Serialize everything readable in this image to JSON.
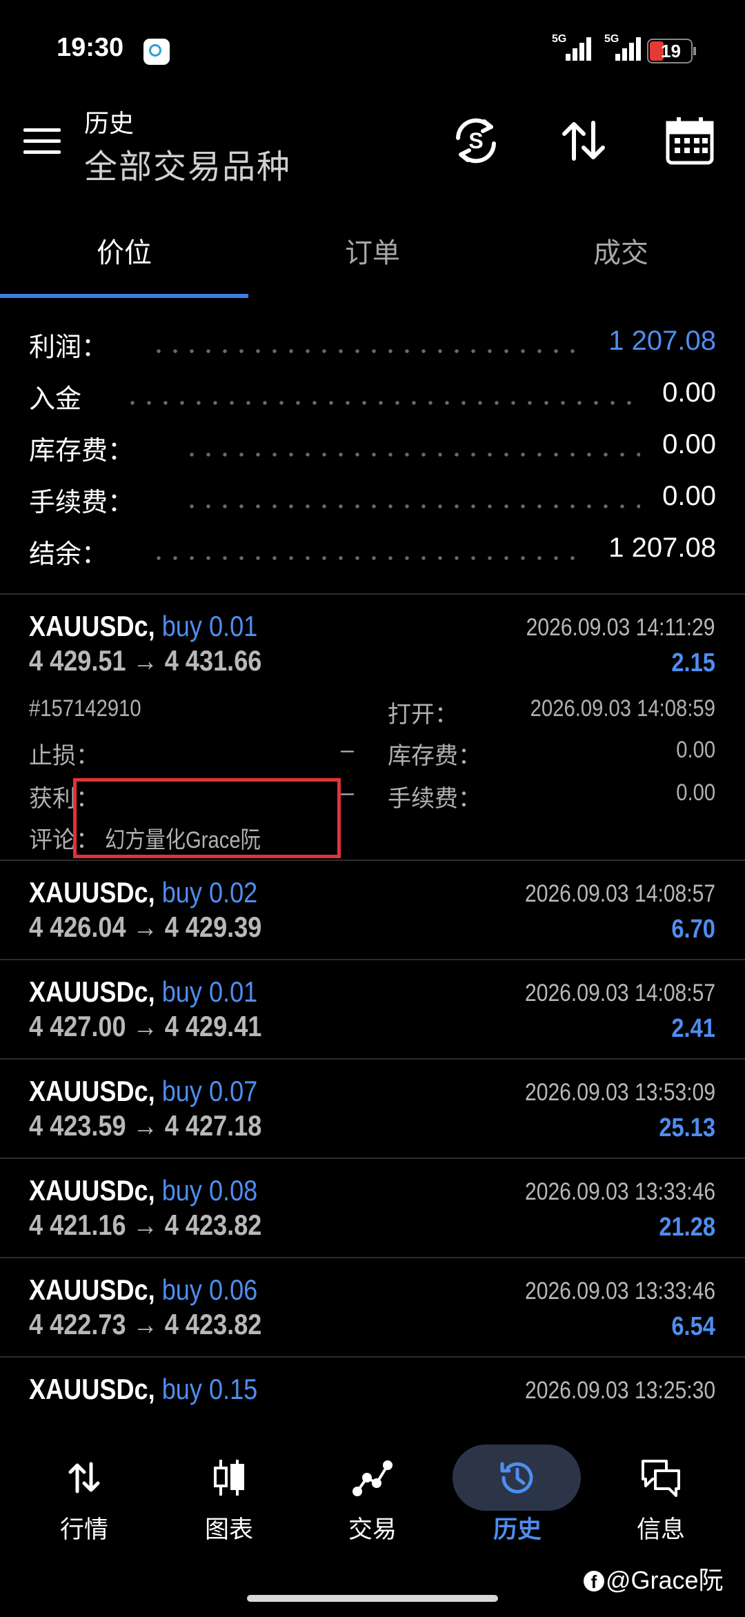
{
  "status_bar": {
    "time": "19:30",
    "signal1_label": "5G",
    "signal2_label": "5G",
    "battery": "19"
  },
  "header": {
    "subtitle": "历史",
    "title": "全部交易品种"
  },
  "tabs": [
    {
      "label": "价位",
      "active": true
    },
    {
      "label": "订单",
      "active": false
    },
    {
      "label": "成交",
      "active": false
    }
  ],
  "summary": [
    {
      "label": "利润：",
      "value": "1 207.08",
      "accent": true
    },
    {
      "label": "入金",
      "value": "0.00",
      "accent": false
    },
    {
      "label": "库存费：",
      "value": "0.00",
      "accent": false
    },
    {
      "label": "手续费：",
      "value": "0.00",
      "accent": false
    },
    {
      "label": "结余：",
      "value": "1 207.08",
      "accent": false
    }
  ],
  "trades": [
    {
      "symbol": "XAUUSDc,",
      "side_volume": "buy 0.01",
      "prices": "4 429.51 → 4 431.66",
      "time": "2026.09.03 14:11:29",
      "profit": "2.15"
    },
    {
      "symbol": "XAUUSDc,",
      "side_volume": "buy 0.02",
      "prices": "4 426.04 → 4 429.39",
      "time": "2026.09.03 14:08:57",
      "profit": "6.70"
    },
    {
      "symbol": "XAUUSDc,",
      "side_volume": "buy 0.01",
      "prices": "4 427.00 → 4 429.41",
      "time": "2026.09.03 14:08:57",
      "profit": "2.41"
    },
    {
      "symbol": "XAUUSDc,",
      "side_volume": "buy 0.07",
      "prices": "4 423.59 → 4 427.18",
      "time": "2026.09.03 13:53:09",
      "profit": "25.13"
    },
    {
      "symbol": "XAUUSDc,",
      "side_volume": "buy 0.08",
      "prices": "4 421.16 → 4 423.82",
      "time": "2026.09.03 13:33:46",
      "profit": "21.28"
    },
    {
      "symbol": "XAUUSDc,",
      "side_volume": "buy 0.06",
      "prices": "4 422.73 → 4 423.82",
      "time": "2026.09.03 13:33:46",
      "profit": "6.54"
    },
    {
      "symbol": "XAUUSDc,",
      "side_volume": "buy 0.15",
      "prices": "",
      "time": "2026.09.03 13:25:30",
      "profit": ""
    }
  ],
  "trade_details": {
    "ticket": "#157142910",
    "open_label": "打开：",
    "open_time": "2026.09.03 14:08:59",
    "sl_label": "止损：",
    "sl_value": "–",
    "swap_label": "库存费：",
    "swap_value": "0.00",
    "tp_label": "获利：",
    "tp_value": "–",
    "commission_label": "手续费：",
    "commission_value": "0.00",
    "comment_label": "评论：",
    "comment_value": "幻方量化Grace阮"
  },
  "bottom_nav": [
    {
      "label": "行情",
      "icon": "quotes-arrows-icon",
      "active": false
    },
    {
      "label": "图表",
      "icon": "candlestick-chart-icon",
      "active": false
    },
    {
      "label": "交易",
      "icon": "trade-line-icon",
      "active": false
    },
    {
      "label": "历史",
      "icon": "history-clock-icon",
      "active": true
    },
    {
      "label": "信息",
      "icon": "messages-icon",
      "active": false
    }
  ],
  "watermark": "@Grace阮",
  "colors": {
    "background": "#000000",
    "accent_blue": "#4f8ef0",
    "highlight_red": "#e0333a",
    "nav_active_bg": "#2b3547"
  }
}
